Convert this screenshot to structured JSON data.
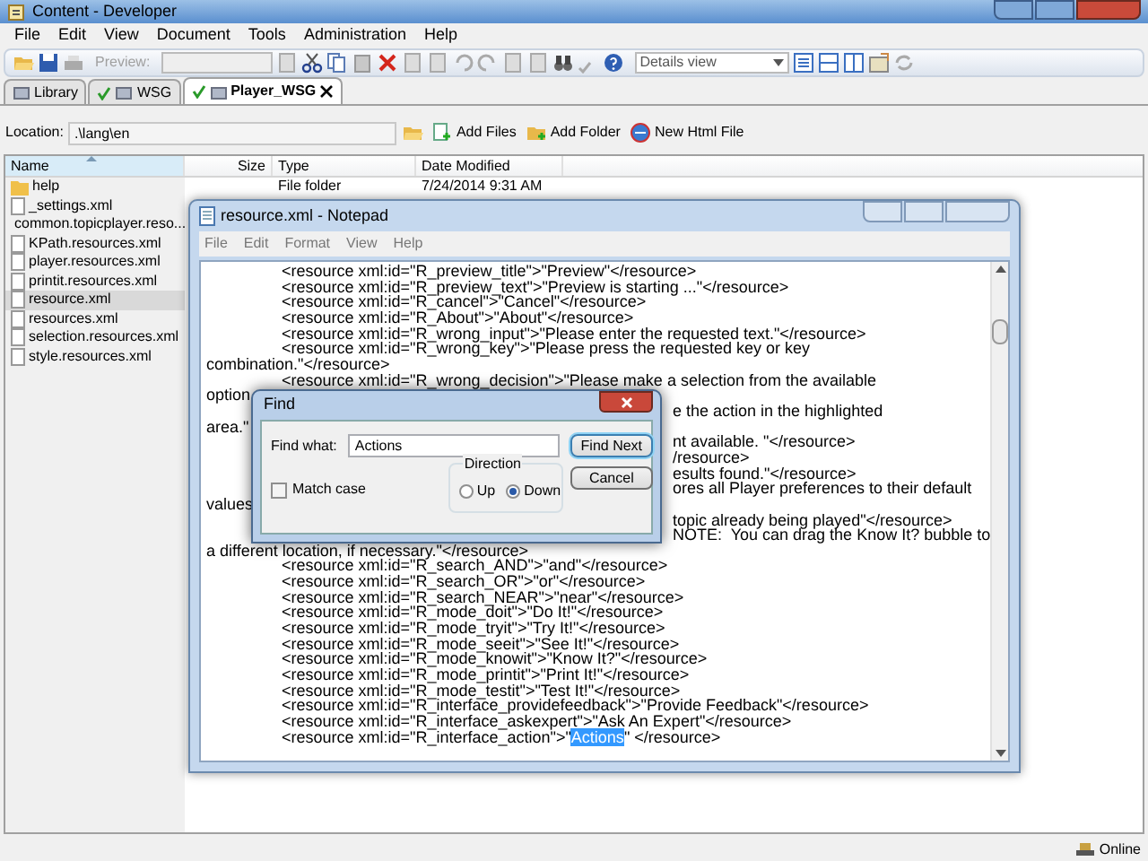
{
  "window": {
    "title": "Content - Developer"
  },
  "menu": [
    "File",
    "Edit",
    "View",
    "Document",
    "Tools",
    "Administration",
    "Help"
  ],
  "toolbar": {
    "preview_button": {
      "label": "Preview:",
      "disabled": true
    },
    "view_select": {
      "value": "Details view"
    }
  },
  "tabs": [
    {
      "label": "Library",
      "selected": false,
      "checked_in": false,
      "closable": false
    },
    {
      "label": "WSG",
      "selected": false,
      "checked_in": true,
      "closable": false
    },
    {
      "label": "Player_WSG",
      "selected": true,
      "checked_in": true,
      "closable": true
    }
  ],
  "location": {
    "label": "Location:",
    "value": ".\\lang\\en",
    "actions": [
      "Add Files",
      "Add Folder",
      "New Html File"
    ]
  },
  "file_list": {
    "columns": [
      {
        "label": "Name",
        "sorted": true
      },
      {
        "label": "Size",
        "sorted": false
      },
      {
        "label": "Type",
        "sorted": false
      },
      {
        "label": "Date Modified",
        "sorted": false
      }
    ],
    "rows": [
      {
        "name": "help",
        "kind": "folder",
        "selected": false,
        "type": "File folder",
        "date_modified": "7/24/2014 9:31 AM"
      },
      {
        "name": "_settings.xml",
        "kind": "file",
        "selected": false
      },
      {
        "name": "common.topicplayer.reso...",
        "kind": "file",
        "selected": false
      },
      {
        "name": "KPath.resources.xml",
        "kind": "file",
        "selected": false
      },
      {
        "name": "player.resources.xml",
        "kind": "file",
        "selected": false
      },
      {
        "name": "printit.resources.xml",
        "kind": "file",
        "selected": false
      },
      {
        "name": "resource.xml",
        "kind": "file",
        "selected": true
      },
      {
        "name": "resources.xml",
        "kind": "file",
        "selected": false
      },
      {
        "name": "selection.resources.xml",
        "kind": "file",
        "selected": false
      },
      {
        "name": "style.resources.xml",
        "kind": "file",
        "selected": false
      }
    ]
  },
  "notepad": {
    "title": "resource.xml - Notepad",
    "menu": [
      "File",
      "Edit",
      "Format",
      "View",
      "Help"
    ],
    "lines": [
      {
        "text": "\t<resource xml:id=\"R_preview_title\">\"Preview\"</resource>"
      },
      {
        "text": "\t<resource xml:id=\"R_preview_text\">\"Preview is starting ...\"</resource>"
      },
      {
        "text": "\t<resource xml:id=\"R_cancel\">\"Cancel\"</resource>"
      },
      {
        "text": "\t<resource xml:id=\"R_About\">\"About\"</resource>"
      },
      {
        "text": "\t<resource xml:id=\"R_wrong_input\">\"Please enter the requested text.\"</resource>"
      },
      {
        "text": "\t<resource xml:id=\"R_wrong_key\">\"Please press the requested key or key"
      },
      {
        "text": "combination.\"</resource>"
      },
      {
        "text": "\t<resource xml:id=\"R_wrong_decision\">\"Please make a selection from the available"
      },
      {
        "text": "option"
      },
      {
        "tail": "e the action in the highlighted"
      },
      {
        "text": "area.\""
      },
      {
        "tail": "nt available. \"</resource>"
      },
      {
        "tail": "/resource>"
      },
      {
        "tail": "esults found.\"</resource>"
      },
      {
        "tail": "ores all Player preferences to their default"
      },
      {
        "text": "values"
      },
      {
        "tail": "topic already being played\"</resource>"
      },
      {
        "tail": "NOTE:  You can drag the Know It? bubble to"
      },
      {
        "text": "a different location, if necessary.\"</resource>"
      },
      {
        "text": "\t<resource xml:id=\"R_search_AND\">\"and\"</resource>"
      },
      {
        "text": "\t<resource xml:id=\"R_search_OR\">\"or\"</resource>"
      },
      {
        "text": "\t<resource xml:id=\"R_search_NEAR\">\"near\"</resource>"
      },
      {
        "text": "\t<resource xml:id=\"R_mode_doit\">\"Do It!\"</resource>"
      },
      {
        "text": "\t<resource xml:id=\"R_mode_tryit\">\"Try It!\"</resource>"
      },
      {
        "text": "\t<resource xml:id=\"R_mode_seeit\">\"See It!\"</resource>"
      },
      {
        "text": "\t<resource xml:id=\"R_mode_knowit\">\"Know It?\"</resource>"
      },
      {
        "text": "\t<resource xml:id=\"R_mode_printit\">\"Print It!\"</resource>"
      },
      {
        "text": "\t<resource xml:id=\"R_mode_testit\">\"Test It!\"</resource>"
      },
      {
        "text": "\t<resource xml:id=\"R_interface_providefeedback\">\"Provide Feedback\"</resource>"
      },
      {
        "text": "\t<resource xml:id=\"R_interface_askexpert\">\"Ask An Expert\"</resource>"
      },
      {
        "text": "\t<resource xml:id=\"R_interface_action\">\"",
        "selected_text": "Actions",
        "after": "\" </resource>"
      }
    ]
  },
  "find_dialog": {
    "title": "Find",
    "find_label": "Find what:",
    "find_value": "Actions",
    "find_next": "Find Next",
    "cancel": "Cancel",
    "direction": {
      "label": "Direction",
      "options": [
        {
          "label": "Up",
          "selected": false
        },
        {
          "label": "Down",
          "selected": true
        }
      ]
    },
    "match_case": {
      "label": "Match case",
      "checked": false
    }
  },
  "status_bar": {
    "status": "Online"
  }
}
